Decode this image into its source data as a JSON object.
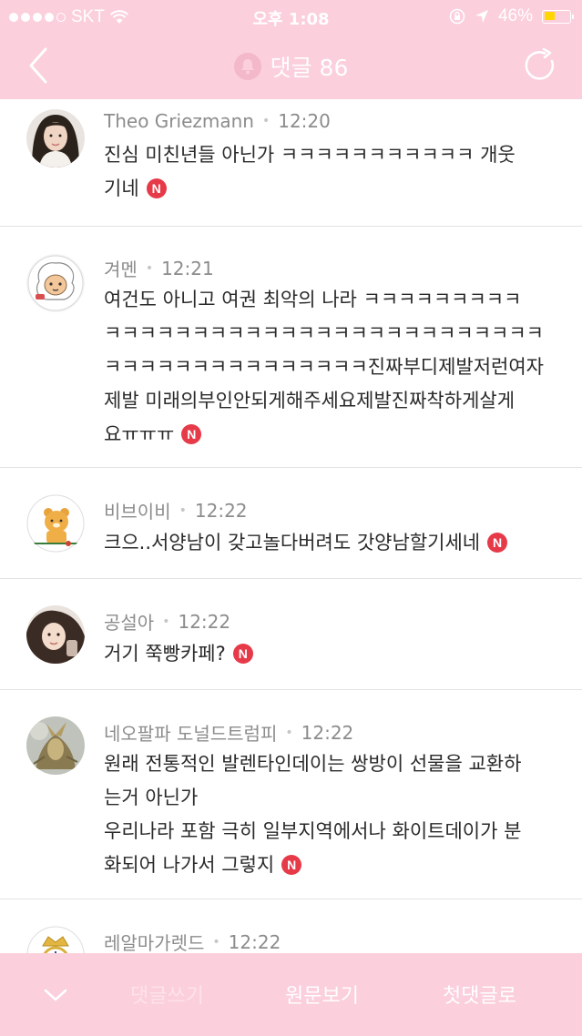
{
  "status_bar": {
    "carrier": "SKT",
    "time": "오후 1:08",
    "battery_percent": "46%",
    "battery_level": 0.46
  },
  "header": {
    "title": "댓글 86",
    "back_icon": "chevron-left-icon",
    "bell_icon": "bell-icon",
    "refresh_icon": "refresh-icon"
  },
  "comments": [
    {
      "author": "Theo Griezmann",
      "time": "12:20",
      "lines": [
        "진심 미친년들 아닌가 ㅋㅋㅋㅋㅋㅋㅋㅋㅋㅋㅋ 개웃",
        "기네"
      ],
      "badge": "N"
    },
    {
      "author": "겨멘",
      "time": "12:21",
      "lines": [
        "여건도 아니고 여권 최악의 나라 ㅋㅋㅋㅋㅋㅋㅋㅋㅋ",
        "ㅋㅋㅋㅋㅋㅋㅋㅋㅋㅋㅋㅋㅋㅋㅋㅋㅋㅋㅋㅋㅋㅋㅋㅋㅋ",
        "ㅋㅋㅋㅋㅋㅋㅋㅋㅋㅋㅋㅋㅋㅋㅋ진짜부디제발저런여자",
        "제발 미래의부인안되게해주세요제발진짜착하게살게",
        "요ㅠㅠㅠ"
      ],
      "badge": "N"
    },
    {
      "author": "비브이비",
      "time": "12:22",
      "lines": [
        "크으..서양남이 갖고놀다버려도 갓양남할기세네"
      ],
      "badge": "N"
    },
    {
      "author": "공설아",
      "time": "12:22",
      "lines": [
        "거기 쭉빵카페?"
      ],
      "badge": "N"
    },
    {
      "author": "네오팔파 도널드트럼피",
      "time": "12:22",
      "lines": [
        "원래 전통적인 발렌타인데이는 쌍방이 선물을 교환하",
        "는거 아닌가",
        "우리나라 포함 극히 일부지역에서나 화이트데이가 분",
        "화되어 나가서 그렇지"
      ],
      "badge": "N"
    },
    {
      "author": "레알마가렛드",
      "time": "12:22",
      "lines": [],
      "badge": ""
    }
  ],
  "bottom_bar": {
    "collapse_icon": "chevron-down-icon",
    "write_comment": "댓글쓰기",
    "view_original": "원문보기",
    "first_comment": "첫댓글로"
  },
  "colors": {
    "brand_pink": "#fbcfdc",
    "new_badge": "#e63a49",
    "meta_gray": "#8c8c8c"
  }
}
